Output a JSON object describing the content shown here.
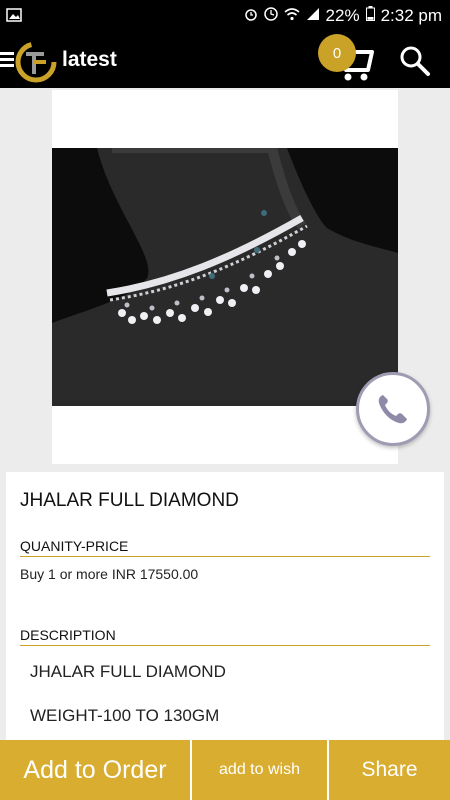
{
  "status": {
    "battery": "22%",
    "time": "2:32 pm"
  },
  "app": {
    "title": "latest",
    "cart_count": "0"
  },
  "product": {
    "title": "JHALAR FULL DIAMOND",
    "price_header": "QUANITY-PRICE",
    "price_text": "Buy 1 or more INR 17550.00",
    "description_header": "DESCRIPTION",
    "description_lines": [
      "JHALAR FULL DIAMOND",
      "WEIGHT-100 TO 130GM"
    ]
  },
  "actions": {
    "add_to_order": "Add to Order",
    "add_to_wish": "add to wish",
    "share": "Share"
  },
  "colors": {
    "accent": "#d9ad2f",
    "bar": "#000000"
  }
}
